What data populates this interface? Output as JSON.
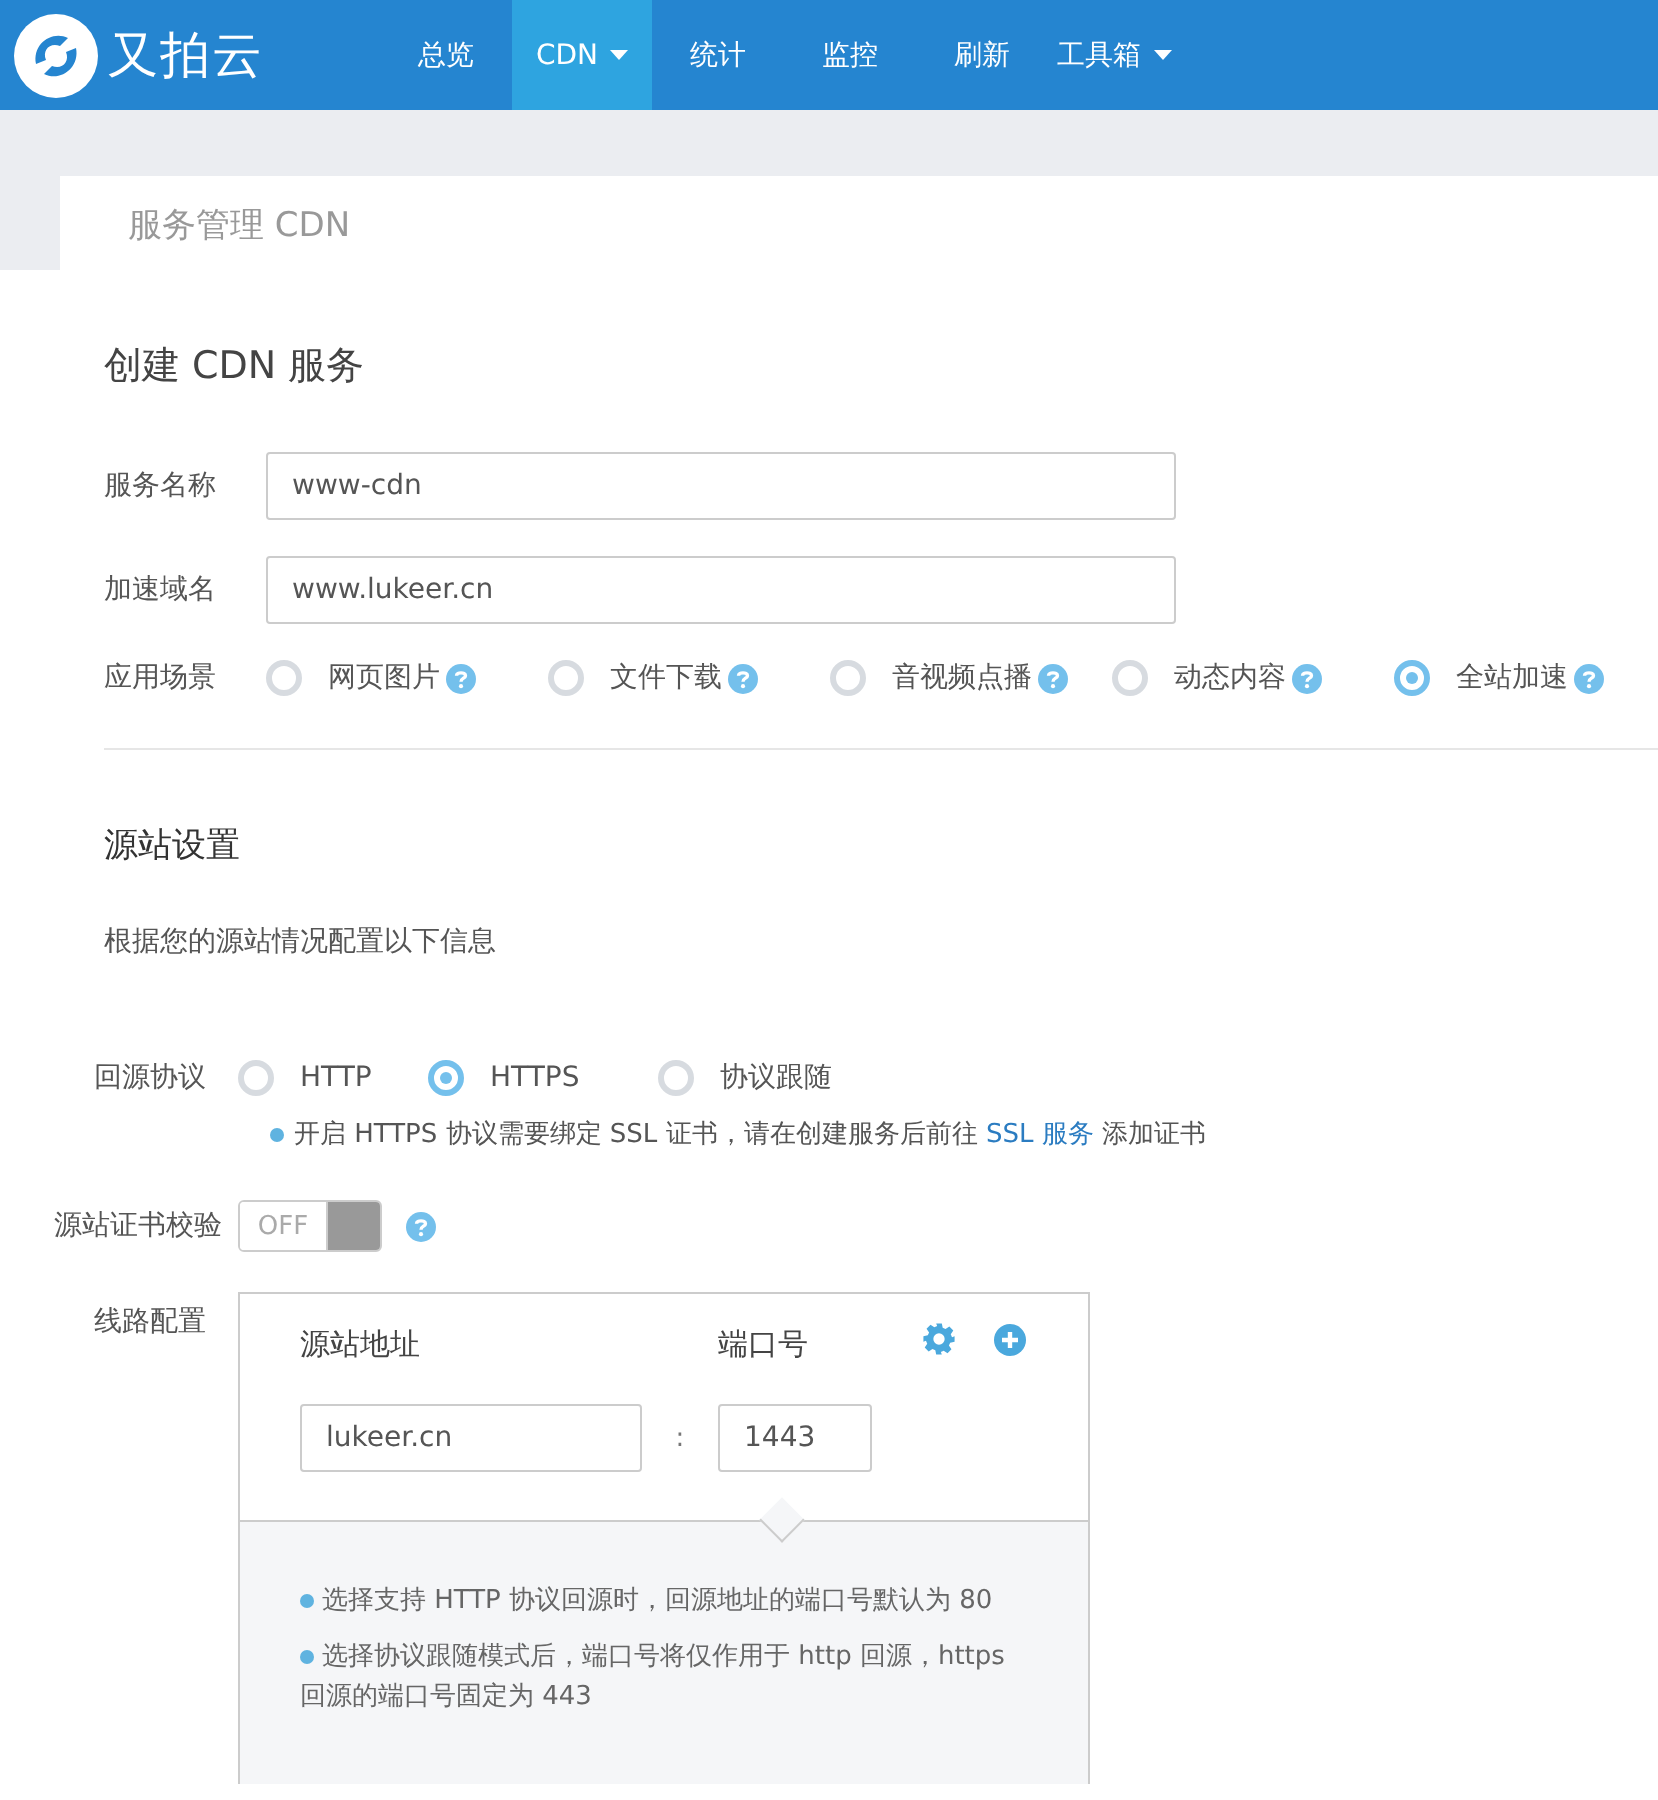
{
  "brand": "又拍云",
  "nav": [
    {
      "label": "总览",
      "selected": false,
      "dropdown": false
    },
    {
      "label": "CDN",
      "selected": true,
      "dropdown": true
    },
    {
      "label": "统计",
      "selected": false,
      "dropdown": false
    },
    {
      "label": "监控",
      "selected": false,
      "dropdown": false
    },
    {
      "label": "刷新",
      "selected": false,
      "dropdown": false
    },
    {
      "label": "工具箱",
      "selected": false,
      "dropdown": true
    }
  ],
  "page_tab": "服务管理 CDN",
  "title": "创建 CDN 服务",
  "fields": [
    {
      "label": "服务名称",
      "value": "www-cdn"
    },
    {
      "label": "加速域名",
      "value": "www.lukeer.cn"
    }
  ],
  "scenario": {
    "label": "应用场景",
    "options": [
      {
        "label": "网页图片",
        "selected": false
      },
      {
        "label": "文件下载",
        "selected": false
      },
      {
        "label": "音视频点播",
        "selected": false
      },
      {
        "label": "动态内容",
        "selected": false
      },
      {
        "label": "全站加速",
        "selected": true
      }
    ]
  },
  "origin": {
    "title": "源站设置",
    "description": "根据您的源站情况配置以下信息",
    "protocol": {
      "label": "回源协议",
      "options": [
        {
          "label": "HTTP",
          "selected": false
        },
        {
          "label": "HTTPS",
          "selected": true
        },
        {
          "label": "协议跟随",
          "selected": false
        }
      ],
      "note_before": "开启 HTTPS 协议需要绑定 SSL 证书，请在创建服务后前往",
      "note_link": "SSL 服务",
      "note_after": "添加证书"
    },
    "cert_check": {
      "label": "源站证书校验",
      "text": "OFF",
      "on": false
    },
    "lines": {
      "label": "线路配置",
      "address_header": "源站地址",
      "port_header": "端口号",
      "address": "lukeer.cn",
      "separator": ":",
      "port": "1443",
      "tips": [
        "选择支持 HTTP 协议回源时，回源地址的端口号默认为 80",
        "选择协议跟随模式后，端口号将仅作用于 http 回源，https 回源的端口号固定为 443"
      ]
    }
  }
}
